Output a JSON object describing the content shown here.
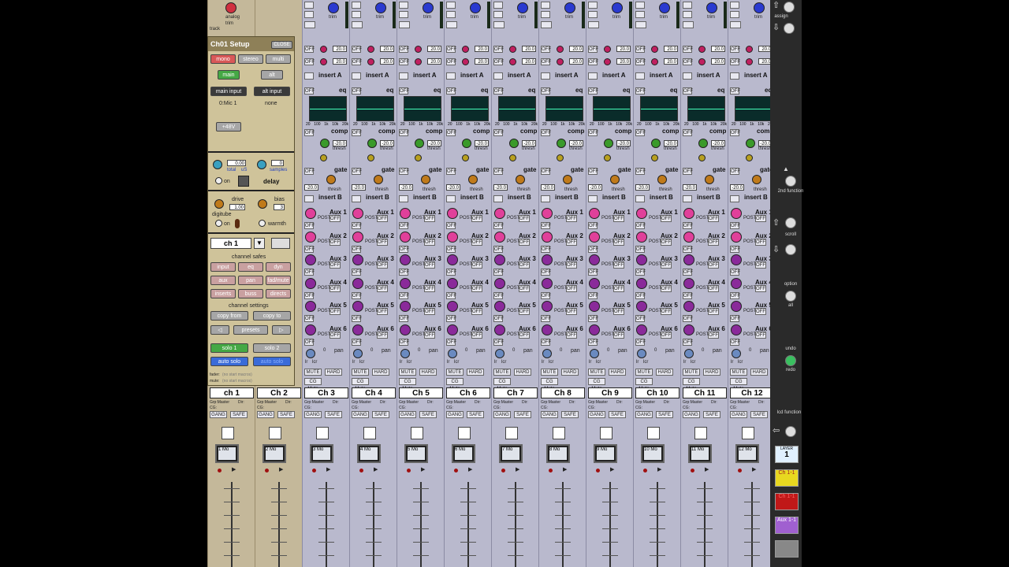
{
  "setup": {
    "title": "Ch01 Setup",
    "close": "CLOSE",
    "mono": "mono",
    "stereo": "stereo",
    "multi": "multi",
    "main": "main",
    "alt": "alt",
    "main_input": "main input",
    "alt_input": "alt input",
    "main_input_value": "0:Mic 1",
    "alt_input_value": "none",
    "phantom": "+48V",
    "delay_value": "0.00",
    "delay_total": "total",
    "delay_unit": "uS",
    "samples_value": "0",
    "samples_label": "samples",
    "delay_on": "on",
    "delay_label": "delay",
    "drive_label": "drive",
    "drive_value": "1.00",
    "bias_label": "bias",
    "bias_value": "3",
    "digitube": "digitube",
    "digitube_on": "on",
    "warmth": "warmth",
    "channel_select": "ch 1",
    "channel_safes": "channel safes",
    "safes": [
      "input",
      "eq",
      "dyn",
      "aux",
      "pan",
      "fad/mute",
      "inserts",
      "buss",
      "directs"
    ],
    "channel_settings": "channel settings",
    "copy_from": "copy from",
    "copy_to": "copy to",
    "presets": "presets",
    "solo1": "solo 1",
    "solo2": "solo 2",
    "auto_solo_1": "auto solo",
    "auto_solo_2": "auto solo",
    "fader_label": "fader:",
    "mute_label": "mute:",
    "no_start_macros": "(no start macros)"
  },
  "strip_labels": {
    "trim": "trim",
    "insert_a": "insert A",
    "insert_b": "insert B",
    "eq": "eq",
    "comp": "comp",
    "gate": "gate",
    "thresh": "thresh",
    "comp_thresh_value": "-20.0",
    "gate_thresh_value": "-20.0",
    "eq_value": "20.0",
    "off": "OFF",
    "post": "POST",
    "pan": "pan",
    "pan_value": "0",
    "lr": "lr",
    "lcr": "lcr",
    "mute": "MUTE",
    "hard": "HARD",
    "cg_mute": "CG Mute",
    "grp_master": "Grp:Master",
    "dir": "Dir:",
    "cg": "CG:",
    "gang": "GANG",
    "safe": "SAFE",
    "aux": [
      "Aux 1",
      "Aux 2",
      "Aux 3",
      "Aux 4",
      "Aux 5",
      "Aux 6"
    ],
    "eq_freqs": [
      "20",
      "100",
      "1k",
      "10k",
      "20k"
    ],
    "analog": "analog",
    "track": "track"
  },
  "channels": [
    {
      "name": "ch 1",
      "scribble": "1 Mo"
    },
    {
      "name": "Ch 2",
      "scribble": "2 Mo"
    },
    {
      "name": "Ch 3",
      "scribble": "3 Mo"
    },
    {
      "name": "Ch 4",
      "scribble": "4 Mo"
    },
    {
      "name": "Ch 5",
      "scribble": "5 Mo"
    },
    {
      "name": "Ch 6",
      "scribble": "6 Mo"
    },
    {
      "name": "Ch 7",
      "scribble": "7 Mo"
    },
    {
      "name": "Ch 8",
      "scribble": "8 Mo"
    },
    {
      "name": "Ch 9",
      "scribble": "9 Mo"
    },
    {
      "name": "Ch 10",
      "scribble": "10 Mo"
    },
    {
      "name": "Ch 11",
      "scribble": "11 Mo"
    },
    {
      "name": "Ch 12",
      "scribble": "12 Mo"
    }
  ],
  "right_panel": {
    "assign": "assign",
    "second_function": "2nd function",
    "scroll": "scroll",
    "option": "option",
    "all": "all",
    "undo": "undo",
    "redo": "redo",
    "lcd_function": "lcd function",
    "layer_label": "LAYER",
    "layer_value": "1",
    "layer_a": "Ch 1-1",
    "layer_b": "Ch 1-1",
    "layer_c": "Aux 1-1",
    "layer_d": ""
  },
  "colors": {
    "strip": "#b9b9cd",
    "setup_panel": "#cfc39a",
    "aux_knob_pink": "#e0409a",
    "aux_knob_purple": "#8a2a9a",
    "trim_knob": "#2a3ad0",
    "comp_knob": "#3a9a2a",
    "gate_knob": "#c07a1a",
    "layer_yellow": "#e8d820",
    "layer_red": "#c01818",
    "layer_purple": "#a060d0"
  }
}
